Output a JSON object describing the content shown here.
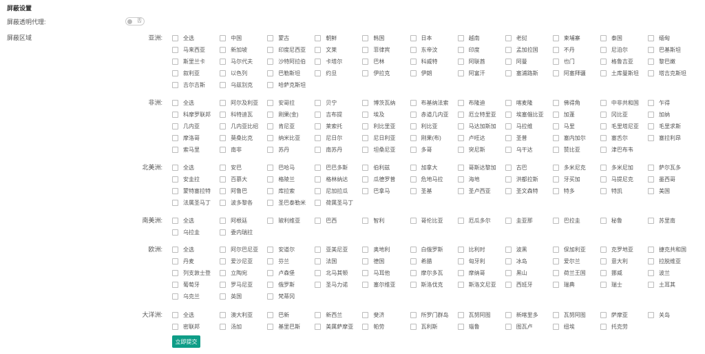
{
  "header": {
    "title": "屏蔽设置"
  },
  "proxy": {
    "label": "屏蔽透明代理:",
    "toggle_text": "否",
    "enabled": false
  },
  "regions_label": "屏蔽区域",
  "regions": [
    {
      "name": "亚洲:",
      "items": [
        "全选",
        "中国",
        "蒙古",
        "朝鲜",
        "韩国",
        "日本",
        "越南",
        "老挝",
        "柬埔寨",
        "泰国",
        "缅甸",
        "马来西亚",
        "新加坡",
        "印度尼西亚",
        "文莱",
        "菲律宾",
        "东帝汶",
        "印度",
        "孟加拉国",
        "不丹",
        "尼泊尔",
        "巴基斯坦",
        "斯里兰卡",
        "马尔代夫",
        "沙特阿拉伯",
        "卡塔尔",
        "巴林",
        "科威特",
        "阿联酋",
        "阿曼",
        "也门",
        "格鲁吉亚",
        "黎巴嫩",
        "叙利亚",
        "以色列",
        "巴勒斯坦",
        "约旦",
        "伊拉克",
        "伊朗",
        "阿富汗",
        "塞浦路斯",
        "阿塞拜疆",
        "土库曼斯坦",
        "塔吉克斯坦",
        "吉尔吉斯",
        "乌兹别克",
        "哈萨克斯坦"
      ]
    },
    {
      "name": "非洲:",
      "items": [
        "全选",
        "阿尔及利亚",
        "安哥拉",
        "贝宁",
        "博茨瓦纳",
        "布基纳法索",
        "布隆迪",
        "喀麦隆",
        "佛得角",
        "中非共和国",
        "乍得",
        "科摩罗联邦",
        "科特迪瓦",
        "刚果(金)",
        "吉布提",
        "埃及",
        "赤道几内亚",
        "厄立特里亚",
        "埃塞俄比亚",
        "加蓬",
        "冈比亚",
        "加纳",
        "几内亚",
        "几内亚比绍",
        "肯尼亚",
        "莱索托",
        "利比里亚",
        "利比亚",
        "马达加斯加",
        "马拉维",
        "马里",
        "毛里塔尼亚",
        "毛里求斯",
        "摩洛哥",
        "莫桑比克",
        "纳米比亚",
        "尼日尔",
        "尼日利亚",
        "刚果(布)",
        "卢旺达",
        "圣普",
        "塞内加尔",
        "塞舌尔",
        "塞拉利昂",
        "索马里",
        "南非",
        "苏丹",
        "南苏丹",
        "坦桑尼亚",
        "多哥",
        "突尼斯",
        "乌干达",
        "赞比亚",
        "津巴布韦"
      ]
    },
    {
      "name": "北美洲:",
      "items": [
        "全选",
        "安巴",
        "巴哈马",
        "巴巴多斯",
        "伯利兹",
        "加拿大",
        "哥斯达黎加",
        "古巴",
        "多米尼克",
        "多米尼加",
        "萨尔瓦多",
        "安圭拉",
        "百慕大",
        "格陵兰",
        "格林纳达",
        "瓜德罗普",
        "危地马拉",
        "海地",
        "洪都拉斯",
        "牙买加",
        "马提尼克",
        "墨西哥",
        "蒙特塞拉特",
        "阿鲁巴",
        "库拉索",
        "尼加拉瓜",
        "巴拿马",
        "圣基",
        "圣卢西亚",
        "圣文森特",
        "特多",
        "特凯",
        "美国",
        "法属圣马丁",
        "波多黎各",
        "圣巴泰勒米",
        "荷属圣马丁"
      ]
    },
    {
      "name": "南美洲:",
      "items": [
        "全选",
        "阿根廷",
        "玻利维亚",
        "巴西",
        "智利",
        "哥伦比亚",
        "厄瓜多尔",
        "圭亚那",
        "巴拉圭",
        "秘鲁",
        "苏里南",
        "乌拉圭",
        "委内瑞拉"
      ]
    },
    {
      "name": "欧洲:",
      "items": [
        "全选",
        "阿尔巴尼亚",
        "安道尔",
        "亚美尼亚",
        "奥地利",
        "白俄罗斯",
        "比利时",
        "波黑",
        "保加利亚",
        "克罗地亚",
        "捷克共和国",
        "丹麦",
        "爱沙尼亚",
        "芬兰",
        "法国",
        "德国",
        "希腊",
        "匈牙利",
        "冰岛",
        "爱尔兰",
        "意大利",
        "拉脱维亚",
        "列支敦士登",
        "立陶宛",
        "卢森堡",
        "北马其顿",
        "马耳他",
        "摩尔多瓦",
        "摩纳哥",
        "黑山",
        "荷兰王国",
        "挪威",
        "波兰",
        "葡萄牙",
        "罗马尼亚",
        "俄罗斯",
        "圣马力诺",
        "塞尔维亚",
        "斯洛伐克",
        "斯洛文尼亚",
        "西班牙",
        "瑞典",
        "瑞士",
        "土耳其",
        "乌克兰",
        "英国",
        "梵蒂冈"
      ]
    },
    {
      "name": "大洋洲:",
      "items": [
        "全选",
        "澳大利亚",
        "巴新",
        "新西兰",
        "斐济",
        "所罗门群岛",
        "瓦努阿图",
        "新喀里多",
        "瓦努阿图",
        "萨摩亚",
        "关岛",
        "密联邦",
        "汤加",
        "基里巴斯",
        "美属萨摩亚",
        "帕劳",
        "瓦利斯",
        "瑙鲁",
        "图瓦卢",
        "纽埃",
        "托克劳"
      ]
    }
  ],
  "submit_label": "立即提交"
}
